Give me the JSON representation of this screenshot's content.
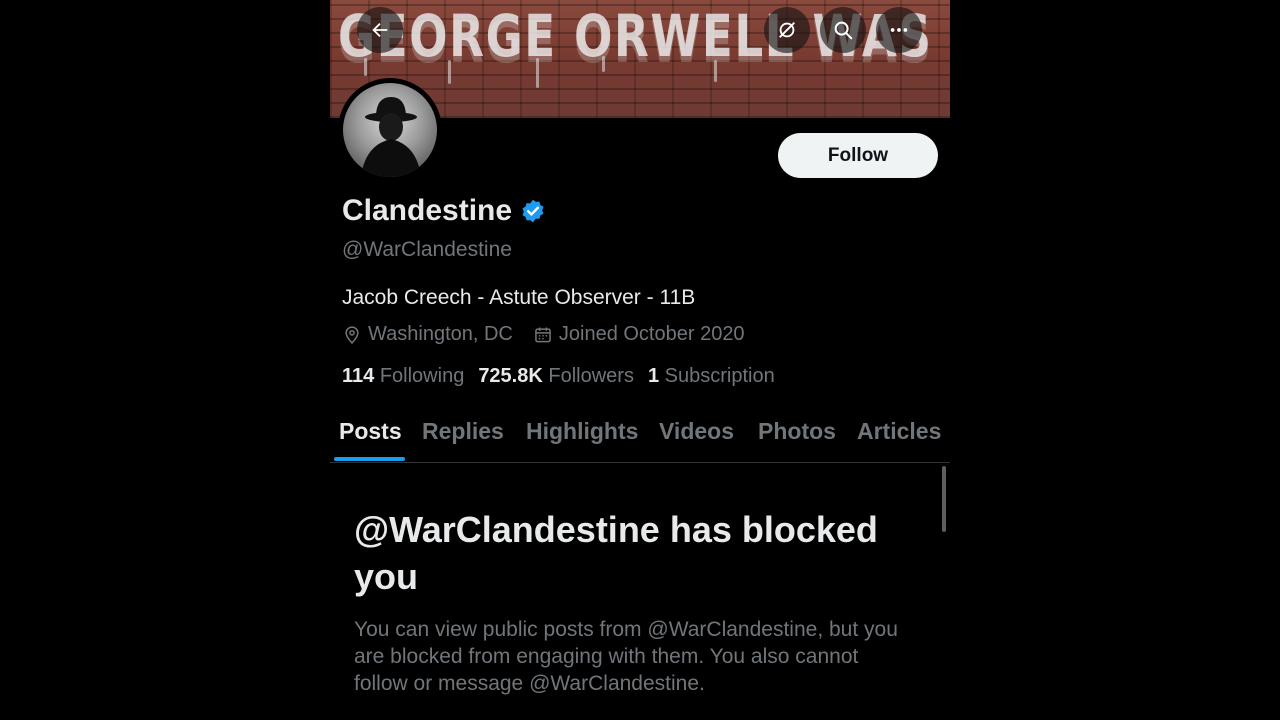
{
  "banner": {
    "graffiti_text": "GEORGE ORWELL WAS RIGHT"
  },
  "header_buttons": {
    "back_icon": "arrow-left-icon",
    "unmute_icon": "eye-slash-icon",
    "search_icon": "search-icon",
    "more_icon": "more-horizontal-icon"
  },
  "profile": {
    "name": "Clandestine",
    "verified_icon": "verified-badge-icon",
    "handle": "@WarClandestine",
    "bio": "Jacob Creech - Astute Observer - 11B",
    "location": "Washington, DC",
    "joined": "Joined October 2020",
    "follow_label": "Follow"
  },
  "stats": {
    "following_count": "114",
    "following_label": "Following",
    "followers_count": "725.8K",
    "followers_label": "Followers",
    "subscription_count": "1",
    "subscription_label": "Subscription"
  },
  "tabs": [
    {
      "label": "Posts",
      "active": true
    },
    {
      "label": "Replies"
    },
    {
      "label": "Highlights"
    },
    {
      "label": "Videos"
    },
    {
      "label": "Photos"
    },
    {
      "label": "Articles"
    }
  ],
  "blocked": {
    "title": "@WarClandestine has blocked you",
    "text": "You can view public posts from @WarClandestine, but you are blocked from engaging with them. You also cannot follow or message @WarClandestine."
  },
  "colors": {
    "accent": "#1d9bf0",
    "background": "#000000",
    "muted": "#71767b",
    "primary_text": "#e7e9ea"
  }
}
